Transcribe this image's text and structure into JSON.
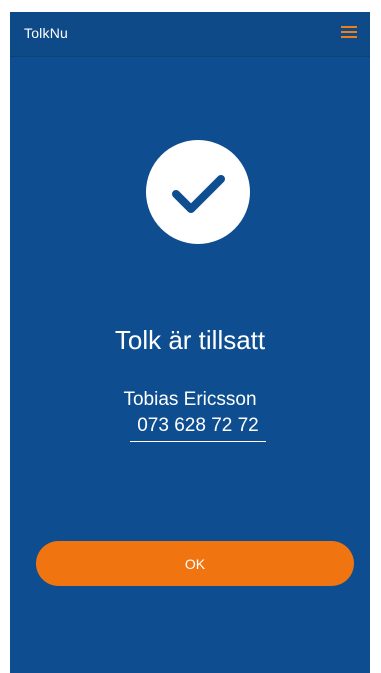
{
  "app": {
    "title": "TolkNu",
    "menu_icon": "hamburger-menu-icon",
    "accent_color": "#f07511",
    "background_color": "#0e4e90"
  },
  "status": {
    "icon": "checkmark-icon",
    "title": "Tolk är tillsatt"
  },
  "interpreter": {
    "name": "Tobias Ericsson",
    "phone": "073 628 72 72"
  },
  "actions": {
    "ok_label": "OK"
  }
}
